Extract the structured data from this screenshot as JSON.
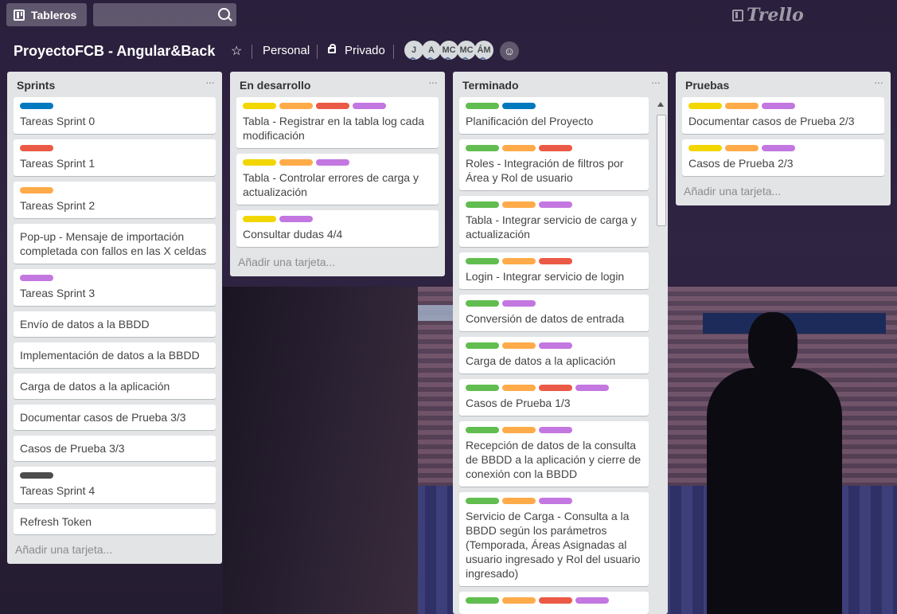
{
  "header": {
    "boards_label": "Tableros",
    "search_placeholder": "",
    "logo": "Trello"
  },
  "board": {
    "title": "ProyectoFCB - Angular&Back",
    "team": "Personal",
    "visibility": "Privado",
    "members": [
      "J",
      "A",
      "MC",
      "MC",
      "ÁM"
    ]
  },
  "colors": {
    "green": "#61bd4f",
    "yellow": "#f2d600",
    "orange": "#ffab4a",
    "red": "#eb5a46",
    "purple": "#c377e0",
    "blue": "#0079bf",
    "black": "#4d4d4d"
  },
  "lists": [
    {
      "title": "Sprints",
      "add_card": "Añadir una tarjeta...",
      "cards": [
        {
          "labels": [
            "blue"
          ],
          "title": "Tareas Sprint 0"
        },
        {
          "labels": [
            "red"
          ],
          "title": "Tareas Sprint 1"
        },
        {
          "labels": [
            "orange"
          ],
          "title": "Tareas Sprint 2"
        },
        {
          "labels": [],
          "title": "Pop-up - Mensaje de importación completada con fallos en las X celdas"
        },
        {
          "labels": [
            "purple"
          ],
          "title": "Tareas Sprint 3"
        },
        {
          "labels": [],
          "title": "Envío de datos a la BBDD"
        },
        {
          "labels": [],
          "title": "Implementación de datos a la BBDD"
        },
        {
          "labels": [],
          "title": "Carga de datos a la aplicación"
        },
        {
          "labels": [],
          "title": "Documentar casos de Prueba 3/3"
        },
        {
          "labels": [],
          "title": "Casos de Prueba 3/3"
        },
        {
          "labels": [
            "black"
          ],
          "title": "Tareas Sprint 4"
        },
        {
          "labels": [],
          "title": "Refresh Token"
        }
      ]
    },
    {
      "title": "En desarrollo",
      "add_card": "Añadir una tarjeta...",
      "cards": [
        {
          "labels": [
            "yellow",
            "orange",
            "red",
            "purple"
          ],
          "title": "Tabla - Registrar en la tabla log cada modificación"
        },
        {
          "labels": [
            "yellow",
            "orange",
            "purple"
          ],
          "title": "Tabla - Controlar errores de carga y actualización"
        },
        {
          "labels": [
            "yellow",
            "purple"
          ],
          "title": "Consultar dudas 4/4"
        }
      ]
    },
    {
      "title": "Terminado",
      "add_card": "",
      "cards": [
        {
          "labels": [
            "green",
            "blue"
          ],
          "title": "Planificación del Proyecto"
        },
        {
          "labels": [
            "green",
            "orange",
            "red"
          ],
          "title": "Roles - Integración de filtros por Área y Rol de usuario"
        },
        {
          "labels": [
            "green",
            "orange",
            "purple"
          ],
          "title": "Tabla - Integrar servicio de carga y actualización"
        },
        {
          "labels": [
            "green",
            "orange",
            "red"
          ],
          "title": "Login - Integrar servicio de login"
        },
        {
          "labels": [
            "green",
            "purple"
          ],
          "title": "Conversión de datos de entrada"
        },
        {
          "labels": [
            "green",
            "orange",
            "purple"
          ],
          "title": "Carga de datos a la aplicación"
        },
        {
          "labels": [
            "green",
            "orange",
            "red",
            "purple"
          ],
          "title": "Casos de Prueba 1/3"
        },
        {
          "labels": [
            "green",
            "orange",
            "purple"
          ],
          "title": "Recepción de datos de la consulta de BBDD a la aplicación y cierre de conexión con la BBDD"
        },
        {
          "labels": [
            "green",
            "orange",
            "purple"
          ],
          "title": "Servicio de Carga - Consulta a la BBDD según los parámetros (Temporada, Áreas Asignadas al usuario ingresado y Rol del usuario ingresado)"
        },
        {
          "labels": [
            "green",
            "orange",
            "red",
            "purple"
          ],
          "title": ""
        }
      ]
    },
    {
      "title": "Pruebas",
      "add_card": "Añadir una tarjeta...",
      "cards": [
        {
          "labels": [
            "yellow",
            "orange",
            "purple"
          ],
          "title": "Documentar casos de Prueba 2/3"
        },
        {
          "labels": [
            "yellow",
            "orange",
            "purple"
          ],
          "title": "Casos de Prueba 2/3"
        }
      ]
    }
  ]
}
